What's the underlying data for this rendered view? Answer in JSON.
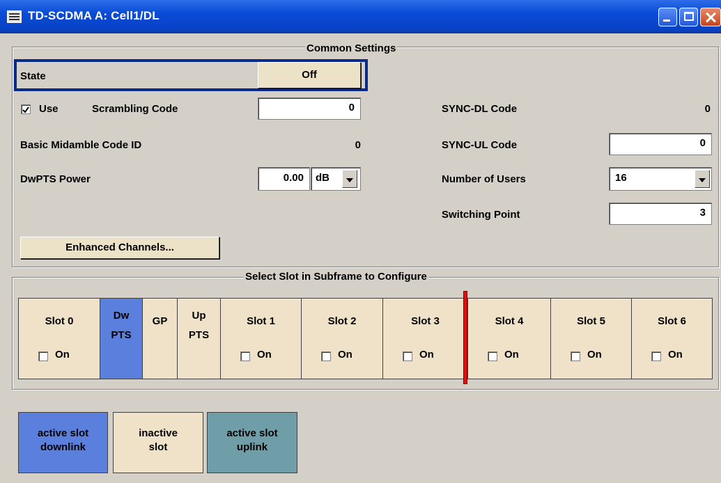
{
  "window": {
    "title": "TD-SCDMA A: Cell1/DL"
  },
  "common": {
    "group_title": "Common Settings",
    "state_label": "State",
    "state_value": "Off",
    "use_label": "Use",
    "use_checked": true,
    "scrambling_label": "Scrambling Code",
    "scrambling_value": "0",
    "sync_dl_label": "SYNC-DL Code",
    "sync_dl_value": "0",
    "midamble_label": "Basic Midamble Code ID",
    "midamble_value": "0",
    "sync_ul_label": "SYNC-UL Code",
    "sync_ul_value": "0",
    "dwpts_label": "DwPTS Power",
    "dwpts_value": "0.00",
    "dwpts_unit": "dB",
    "users_label": "Number of Users",
    "users_value": "16",
    "switching_label": "Switching Point",
    "switching_value": "3",
    "enhanced_button": "Enhanced Channels..."
  },
  "slots": {
    "group_title": "Select Slot in Subframe to Configure",
    "on_label": "On",
    "items": [
      {
        "line1": "Slot 0",
        "line2": "",
        "type": "inactive",
        "has_checkbox": true
      },
      {
        "line1": "Dw",
        "line2": "PTS",
        "type": "downlink",
        "has_checkbox": false
      },
      {
        "line1": "GP",
        "line2": "",
        "type": "inactive",
        "has_checkbox": false
      },
      {
        "line1": "Up",
        "line2": "PTS",
        "type": "inactive",
        "has_checkbox": false
      },
      {
        "line1": "Slot 1",
        "line2": "",
        "type": "inactive",
        "has_checkbox": true
      },
      {
        "line1": "Slot 2",
        "line2": "",
        "type": "inactive",
        "has_checkbox": true
      },
      {
        "line1": "Slot 3",
        "line2": "",
        "type": "inactive",
        "has_checkbox": true
      },
      {
        "line1": "Slot 4",
        "line2": "",
        "type": "inactive",
        "has_checkbox": true
      },
      {
        "line1": "Slot 5",
        "line2": "",
        "type": "inactive",
        "has_checkbox": true
      },
      {
        "line1": "Slot 6",
        "line2": "",
        "type": "inactive",
        "has_checkbox": true
      }
    ]
  },
  "legend": [
    {
      "line1": "active slot",
      "line2": "downlink",
      "color": "#5b7fdd"
    },
    {
      "line1": "inactive",
      "line2": "slot",
      "color": "#f0e2c8"
    },
    {
      "line1": "active slot",
      "line2": "uplink",
      "color": "#6f9ea8"
    }
  ],
  "colors": {
    "switch_marker": "#e01010",
    "downlink": "#5b7fdd",
    "inactive": "#f0e2c8",
    "uplink": "#6f9ea8"
  }
}
